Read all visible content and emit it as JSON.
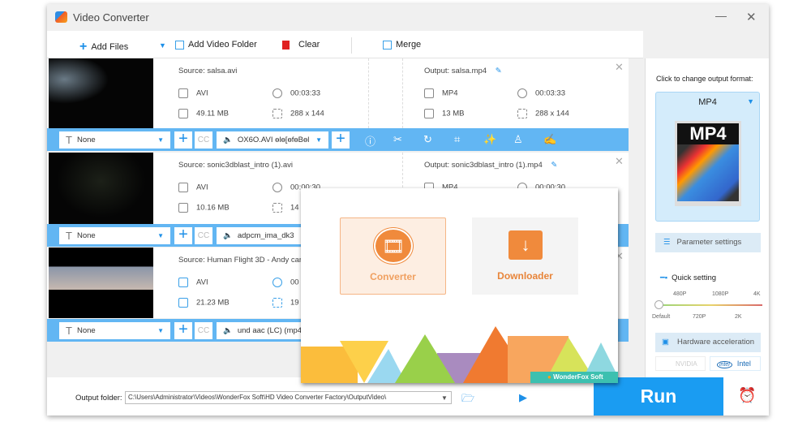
{
  "window": {
    "title": "Video Converter",
    "minimize_icon": "minimize-icon",
    "close_icon": "close-icon"
  },
  "toolbar": {
    "add_files": "Add Files",
    "add_folder": "Add Video Folder",
    "clear": "Clear",
    "merge": "Merge"
  },
  "files": [
    {
      "source": "Source: salsa.avi",
      "src_format": "AVI",
      "src_duration": "00:03:33",
      "src_size": "49.11 MB",
      "src_resolution": "288 x 144",
      "output": "Output: salsa.mp4",
      "out_format": "MP4",
      "out_duration": "00:03:33",
      "out_size": "13 MB",
      "out_resolution": "288 x 144",
      "subtitle": "None",
      "audio": "OX6O.AVI ɵlɵ[ɵfɵBɵl"
    },
    {
      "source": "Source: sonic3dblast_intro (1).avi",
      "src_format": "AVI",
      "src_duration": "00:00:30",
      "src_size": "10.16 MB",
      "src_resolution": "14",
      "output": "Output: sonic3dblast_intro (1).mp4",
      "out_format": "MP4",
      "out_duration": "00:00:30",
      "subtitle": "None",
      "audio": "adpcm_ima_dk3"
    },
    {
      "source": "Source: Human Flight 3D - Andy can",
      "src_format": "AVI",
      "src_duration": "00",
      "src_size": "21.23 MB",
      "src_resolution": "19",
      "subtitle": "None",
      "audio": "und aac (LC) (mp4"
    }
  ],
  "right_panel": {
    "hint": "Click to change output format:",
    "format": "MP4",
    "format_icon_text": "MP4",
    "parameter_settings": "Parameter settings",
    "quick_setting": "Quick setting",
    "quality_top": [
      "480P",
      "1080P",
      "4K"
    ],
    "quality_bottom": [
      "Default",
      "720P",
      "2K"
    ],
    "quality_selected": "Default",
    "hardware_acceleration": "Hardware acceleration",
    "nvidia": "NVIDIA",
    "intel": "Intel"
  },
  "bottom": {
    "output_folder_label": "Output folder:",
    "output_folder_value": "C:\\Users\\Administrator\\Videos\\WonderFox Soft\\HD Video Converter Factory\\OutputVideo\\",
    "run": "Run"
  },
  "popup": {
    "converter": "Converter",
    "downloader": "Downloader",
    "brand": "WonderFox Soft"
  },
  "colors": {
    "accent": "#62b6f3",
    "run": "#1a9cf2",
    "orange": "#f08a3c"
  }
}
